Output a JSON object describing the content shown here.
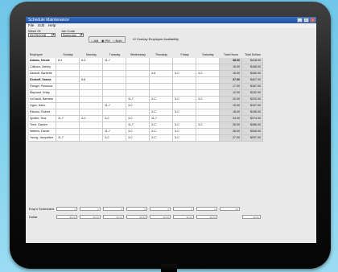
{
  "window": {
    "title": "Schedule Maintenance",
    "controls": [
      "minimize-icon",
      "maximize-icon",
      "close-icon"
    ]
  },
  "menu": [
    "File",
    "Edit",
    "Help"
  ],
  "filters": {
    "week_of_label": "Week Of",
    "week_of_value": "05/25/2008",
    "job_code_label": "Job Code",
    "job_code_value": "Bartender",
    "shift_options": [
      "AM",
      "PM",
      "Both"
    ],
    "shift_selected": "PM",
    "overlay_label": "Overlay Employee Availability",
    "overlay_checked": true
  },
  "columns": [
    "Employee",
    "Sunday",
    "Monday",
    "Tuesday",
    "Wednesday",
    "Thursday",
    "Friday",
    "Saturday",
    "Total Hours",
    "Total Dollars"
  ],
  "employees": [
    {
      "name": "Adams, Nicole",
      "shifts": [
        "8-4",
        "8-4",
        "11-7",
        "",
        "",
        "",
        ""
      ],
      "hours": "38.00",
      "dollars": "$418.00",
      "bold": true
    },
    {
      "name": "Calhoun, Ashley",
      "shifts": [
        "",
        "",
        "",
        "",
        "",
        "",
        ""
      ],
      "hours": "16.00",
      "dollars": "$168.00"
    },
    {
      "name": "Dimkoff, Barbette",
      "shifts": [
        "",
        "",
        "",
        "",
        "4-6",
        "3-C",
        "3-C"
      ],
      "hours": "16.00",
      "dollars": "$160.00"
    },
    {
      "name": "Dimkoff, Samra",
      "shifts": [
        "",
        "8-6",
        "",
        "",
        "",
        "",
        ""
      ],
      "hours": "37.00",
      "dollars": "$407.00",
      "bold": true
    },
    {
      "name": "Flauger, Rebecca",
      "shifts": [
        "",
        "",
        "",
        "",
        "",
        "",
        ""
      ],
      "hours": "17.00",
      "dollars": "$187.00"
    },
    {
      "name": "Maynard, Kristy",
      "shifts": [
        "",
        "",
        "",
        "",
        "",
        "",
        ""
      ],
      "hours": "12.00",
      "dollars": "$132.00"
    },
    {
      "name": "LeGrand, Barbara",
      "shifts": [
        "",
        "",
        "",
        "11-7",
        "3-C",
        "3-C",
        "3-C"
      ],
      "hours": "20.00",
      "dollars": "$220.00"
    },
    {
      "name": "Ogen, Harlo",
      "shifts": [
        "",
        "",
        "11-7",
        "3-C",
        "",
        "",
        ""
      ],
      "hours": "15.00",
      "dollars": "$157.00"
    },
    {
      "name": "Palumo, Robert",
      "shifts": [
        "",
        "",
        "",
        "",
        "3-C",
        "3-C",
        ""
      ],
      "hours": "18.00",
      "dollars": "$198.00"
    },
    {
      "name": "Spotter, Tina",
      "shifts": [
        "11-7",
        "3-C",
        "3-C",
        "3-C",
        "11-7",
        "",
        ""
      ],
      "hours": "34.00",
      "dollars": "$374.00"
    },
    {
      "name": "Trent, Damen",
      "shifts": [
        "",
        "",
        "",
        "11-7",
        "3-C",
        "3-C",
        "3-C"
      ],
      "hours": "26.00",
      "dollars": "$286.00"
    },
    {
      "name": "Walters, Darcie",
      "shifts": [
        "",
        "",
        "11-7",
        "3-C",
        "3-C",
        "3-C",
        ""
      ],
      "hours": "28.00",
      "dollars": "$308.00"
    },
    {
      "name": "Young, Jacqueline",
      "shifts": [
        "11-7",
        "",
        "3-C",
        "3-C",
        "3-C",
        "3-C",
        ""
      ],
      "hours": "27.00",
      "dollars": "$297.00"
    }
  ],
  "footer": {
    "scheduled_label": "Emp's Scheduled",
    "scheduled_values": [
      "6",
      "6",
      "6",
      "6",
      "8",
      "6",
      "6",
      "66"
    ],
    "dollars_label": "Dollar",
    "dollar_values": [
      "$0.00",
      "$0.00",
      "$0.00",
      "$0.00",
      "$0.00",
      "$0.00",
      "$0.00",
      "$0.00"
    ]
  },
  "colors": {
    "orange": "#f28c28",
    "yellow": "#f6e12f",
    "titlebar": "#2a5fb6",
    "totals_bg": "#d9d9d9"
  }
}
